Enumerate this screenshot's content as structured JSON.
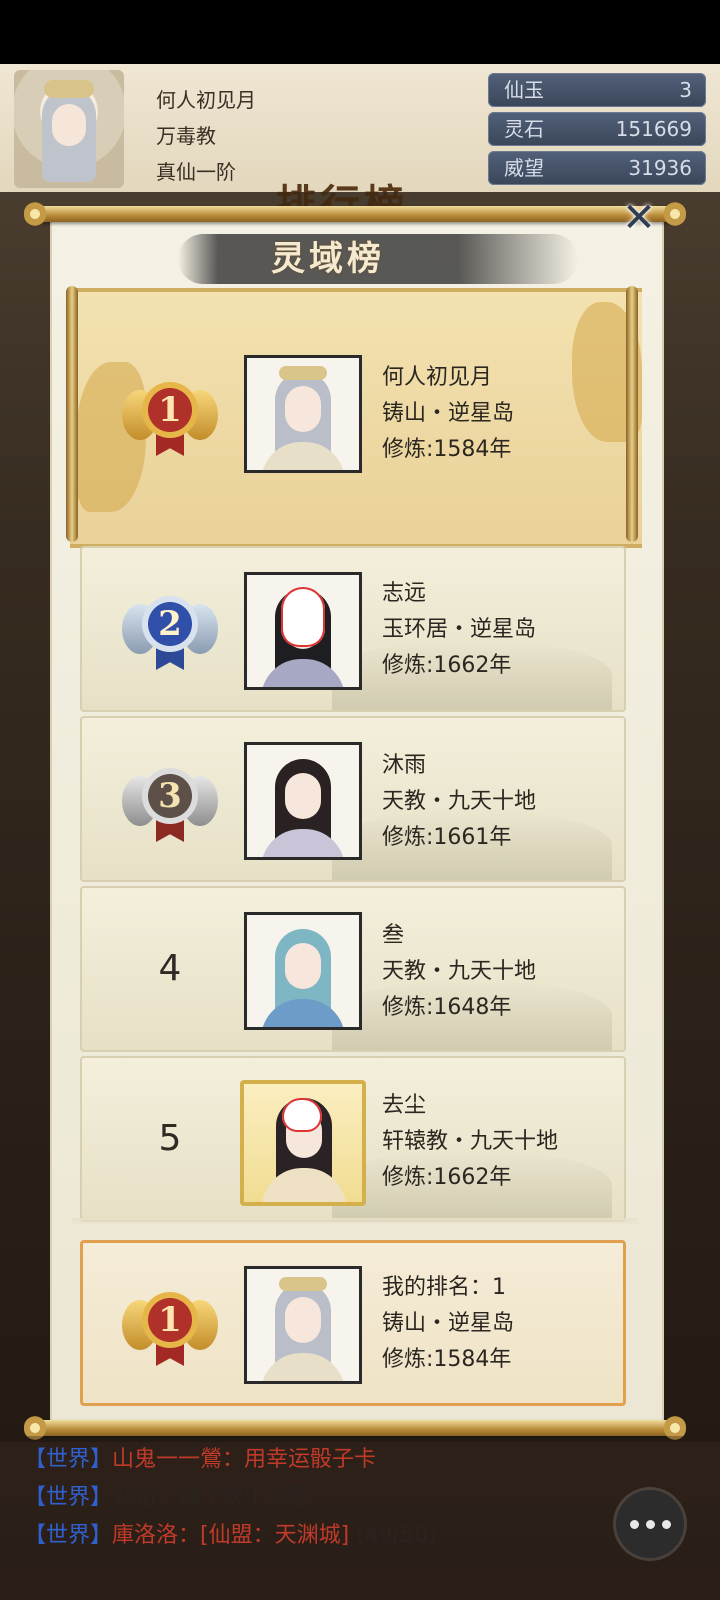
{
  "header": {
    "player_name": "何人初见月",
    "sect": "万毒教",
    "realm": "真仙一阶",
    "bg_title": "排行榜"
  },
  "resources": [
    {
      "label": "仙玉",
      "value": "3"
    },
    {
      "label": "灵石",
      "value": "151669"
    },
    {
      "label": "威望",
      "value": "31936"
    }
  ],
  "modal": {
    "title": "灵域榜",
    "close_icon": "close-x-icon"
  },
  "rankings": [
    {
      "rank": "1",
      "name": "何人初见月",
      "location": "铸山・逆星岛",
      "cultivation": "修炼:1584年",
      "medal": "gold"
    },
    {
      "rank": "2",
      "name": "志远",
      "location": "玉环居・逆星岛",
      "cultivation": "修炼:1662年",
      "medal": "silver"
    },
    {
      "rank": "3",
      "name": "沐雨",
      "location": "天教・九天十地",
      "cultivation": "修炼:1661年",
      "medal": "bronze"
    },
    {
      "rank": "4",
      "name": "叁",
      "location": "天教・九天十地",
      "cultivation": "修炼:1648年"
    },
    {
      "rank": "5",
      "name": "去尘",
      "location": "轩辕教・九天十地",
      "cultivation": "修炼:1662年"
    }
  ],
  "my_rank": {
    "rank": "1",
    "label": "我的排名：1",
    "location": "铸山・逆星岛",
    "cultivation": "修炼:1584年"
  },
  "chat": [
    {
      "channel": "【世界】",
      "name": "山鬼一一鶯",
      "sep": "：",
      "msg": "用幸运骰子卡"
    },
    {
      "channel": "【世界】",
      "name": "刘旬",
      "sep": "：",
      "msg": "换了快十次图"
    },
    {
      "channel": "【世界】",
      "name": "庫洛洛",
      "sep": "：",
      "msg": "[仙盟：天渊城]",
      "extra": "(49/50)"
    }
  ]
}
